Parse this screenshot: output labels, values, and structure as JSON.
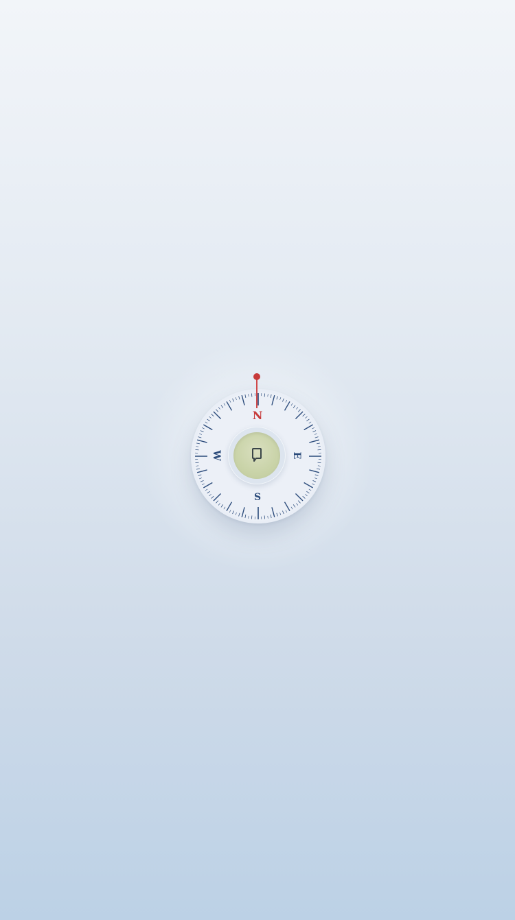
{
  "compass": {
    "cardinals": {
      "north": "N",
      "east": "E",
      "south": "S",
      "west": "W"
    },
    "north_color": "#c73a3a",
    "tick_color": "#2a4a7a"
  },
  "center_button": {
    "icon": "location-pin-icon"
  }
}
